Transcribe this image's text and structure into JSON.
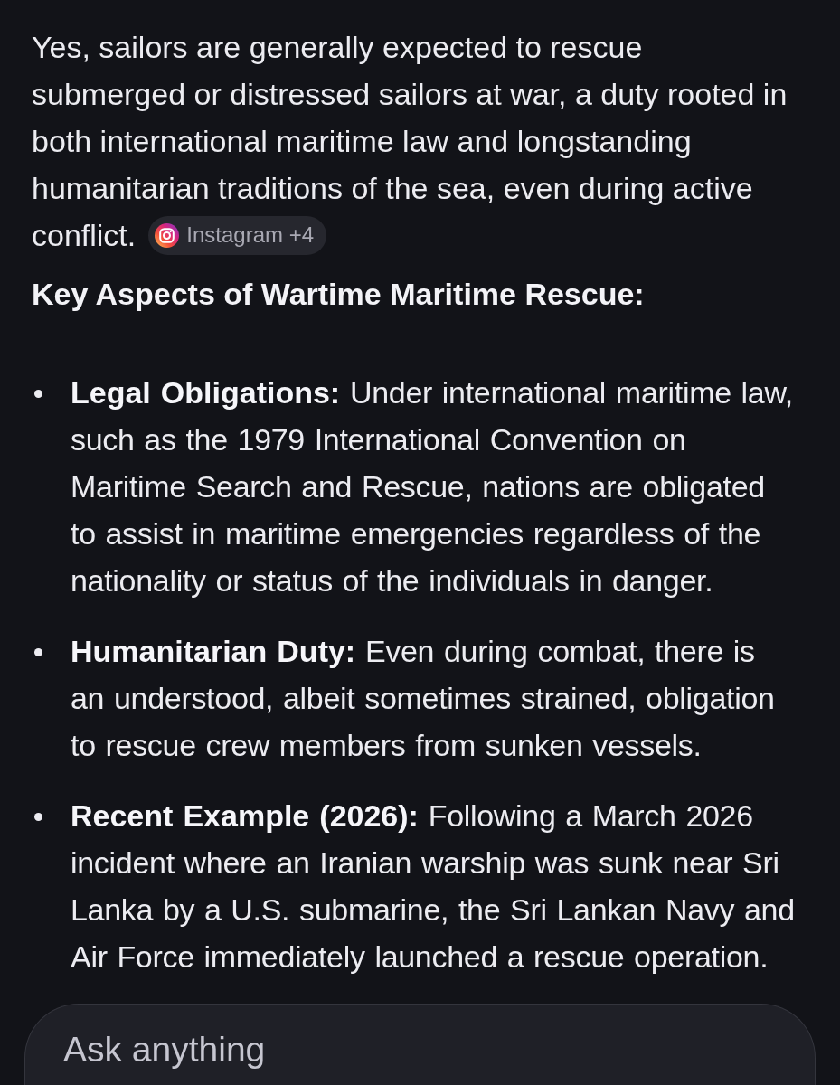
{
  "answer": {
    "text": "Yes, sailors are generally expected to rescue submerged or distressed sailors at war, a duty rooted in both international maritime law and longstanding humanitarian traditions of the sea, even during active conflict.",
    "source_chip": {
      "label": "Instagram +4"
    }
  },
  "section_heading": "Key Aspects of Wartime Maritime Rescue:",
  "bullets": [
    {
      "text": "**Legal Obligations:** Under international maritime law, such as the 1979 International Convention on Maritime Search and Rescue, nations are obligated to assist in maritime emergencies regardless of the nationality or status of the individuals in danger."
    },
    {
      "text": "**Humanitarian Duty:** Even during combat, there is an understood, albeit sometimes strained, obligation to rescue crew members from sunken vessels."
    },
    {
      "text": "**Recent Example (2026):** Following a March 2026 incident where an Iranian warship was sunk near Sri Lanka by a U.S. submarine, the Sri Lankan Navy and Air Force immediately launched a rescue operation."
    }
  ],
  "input": {
    "placeholder": "Ask anything"
  }
}
